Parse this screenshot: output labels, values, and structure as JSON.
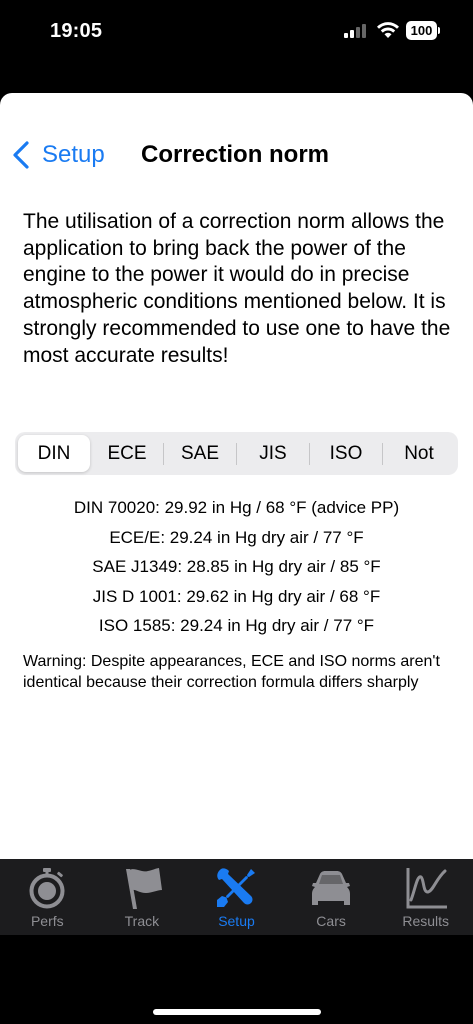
{
  "status": {
    "time": "19:05",
    "battery": "100"
  },
  "nav": {
    "back_label": "Setup",
    "title": "Correction norm"
  },
  "description": "The utilisation of a correction norm allows the application to bring back the power of the engine to the power it would do in precise atmospheric conditions mentioned below. It is strongly recommended to use one to have the most accurate results!",
  "segments": {
    "selected": "DIN",
    "items": [
      "DIN",
      "ECE",
      "SAE",
      "JIS",
      "ISO",
      "Not"
    ]
  },
  "norms": [
    "DIN 70020: 29.92 in Hg / 68 °F (advice PP)",
    "ECE/E: 29.24 in Hg dry air / 77 °F",
    "SAE J1349: 28.85 in Hg dry air / 85 °F",
    "JIS D 1001: 29.62 in Hg dry air / 68 °F",
    "ISO 1585: 29.24 in Hg dry air / 77 °F"
  ],
  "warning": "Warning: Despite appearances, ECE and ISO norms aren't identical because their correction formula differs sharply",
  "tabbar": {
    "active": "Setup",
    "items": [
      {
        "label": "Perfs",
        "icon": "stopwatch-icon"
      },
      {
        "label": "Track",
        "icon": "flag-icon"
      },
      {
        "label": "Setup",
        "icon": "tools-icon"
      },
      {
        "label": "Cars",
        "icon": "car-icon"
      },
      {
        "label": "Results",
        "icon": "chart-icon"
      }
    ]
  },
  "colors": {
    "accent": "#1a7bf2",
    "tab_inactive": "#8e8e93",
    "tabbar_bg": "#1c1c1e"
  }
}
